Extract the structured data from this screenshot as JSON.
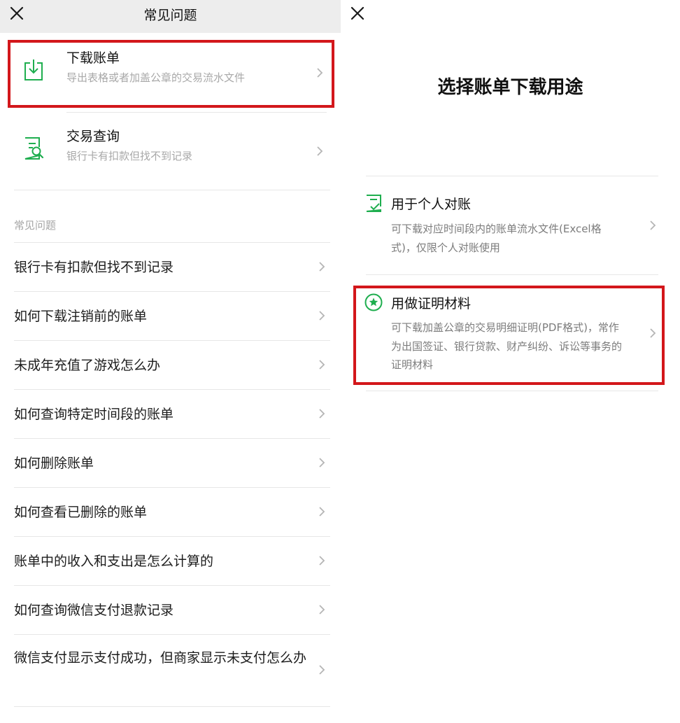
{
  "left_screen": {
    "header": {
      "title": "常见问题",
      "close_icon": "close-icon"
    },
    "cards": [
      {
        "title": "下载账单",
        "subtitle": "导出表格或者加盖公章的交易流水文件",
        "icon": "download-icon"
      },
      {
        "title": "交易查询",
        "subtitle": "银行卡有扣款但找不到记录",
        "icon": "document-search-icon"
      }
    ],
    "section_title": "常见问题",
    "faq_items": [
      "银行卡有扣款但找不到记录",
      "如何下载注销前的账单",
      "未成年充值了游戏怎么办",
      "如何查询特定时间段的账单",
      "如何删除账单",
      "如何查看已删除的账单",
      "账单中的收入和支出是怎么计算的",
      "如何查询微信支付退款记录",
      "微信支付显示支付成功，但商家显示未支付怎么办"
    ]
  },
  "right_screen": {
    "close_icon": "close-icon",
    "title": "选择账单下载用途",
    "options": [
      {
        "title": "用于个人对账",
        "description": "可下载对应时间段内的账单流水文件(Excel格式)，仅限个人对账使用",
        "icon": "checklist-icon"
      },
      {
        "title": "用做证明材料",
        "description": "可下载加盖公章的交易明细证明(PDF格式)，常作为出国签证、银行贷款、财产纠纷、诉讼等事务的证明材料",
        "icon": "star-badge-icon"
      }
    ]
  },
  "colors": {
    "accent_green": "#1fae4f",
    "highlight_red": "#d3171b",
    "header_gray": "#ededed",
    "secondary_text": "#a8a8a8"
  }
}
